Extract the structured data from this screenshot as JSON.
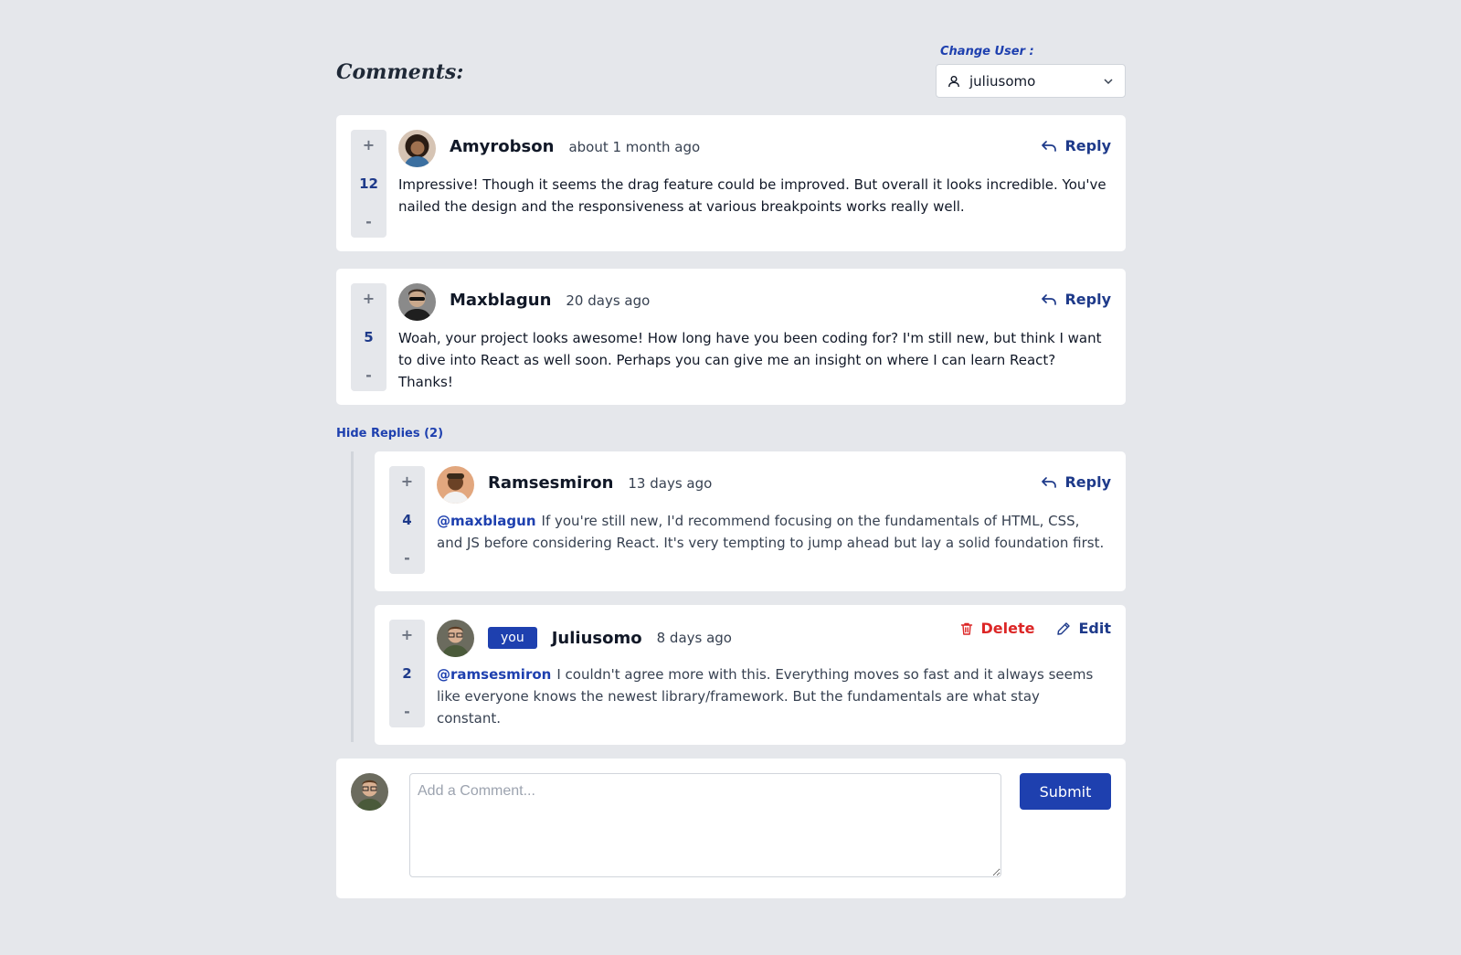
{
  "header": {
    "title": "Comments:",
    "user_switch_label": "Change User :",
    "selected_user": "juliusomo"
  },
  "comments": [
    {
      "author": "Amyrobson",
      "time": "about 1 month ago",
      "score": "12",
      "text": "Impressive! Though it seems the drag feature could be improved. But overall it looks incredible. You've nailed the design and the responsiveness at various breakpoints works really well.",
      "reply_label": "Reply"
    },
    {
      "author": "Maxblagun",
      "time": "20 days ago",
      "score": "5",
      "text": "Woah, your project looks awesome! How long have you been coding for? I'm still new, but think I want to dive into React as well soon. Perhaps you can give me an insight on where I can learn React? Thanks!",
      "reply_label": "Reply"
    }
  ],
  "replies_toggle": "Hide Replies (2)",
  "replies": [
    {
      "author": "Ramsesmiron",
      "time": "13 days ago",
      "score": "4",
      "mention": "@maxblagun",
      "text": "If you're still new, I'd recommend focusing on the fundamentals of HTML, CSS, and JS before considering React. It's very tempting to jump ahead but lay a solid foundation first.",
      "reply_label": "Reply"
    },
    {
      "author": "Juliusomo",
      "badge": "you",
      "time": "8 days ago",
      "score": "2",
      "mention": "@ramsesmiron",
      "text": "I couldn't agree more with this. Everything moves so fast and it always seems like everyone knows the newest library/framework. But the fundamentals are what stay constant.",
      "delete_label": "Delete",
      "edit_label": "Edit"
    }
  ],
  "vote": {
    "plus": "+",
    "minus": "-"
  },
  "composer": {
    "placeholder": "Add a Comment...",
    "submit_label": "Submit"
  },
  "colors": {
    "accent": "#1e40af",
    "danger": "#dc2626",
    "background": "#e5e7eb"
  }
}
